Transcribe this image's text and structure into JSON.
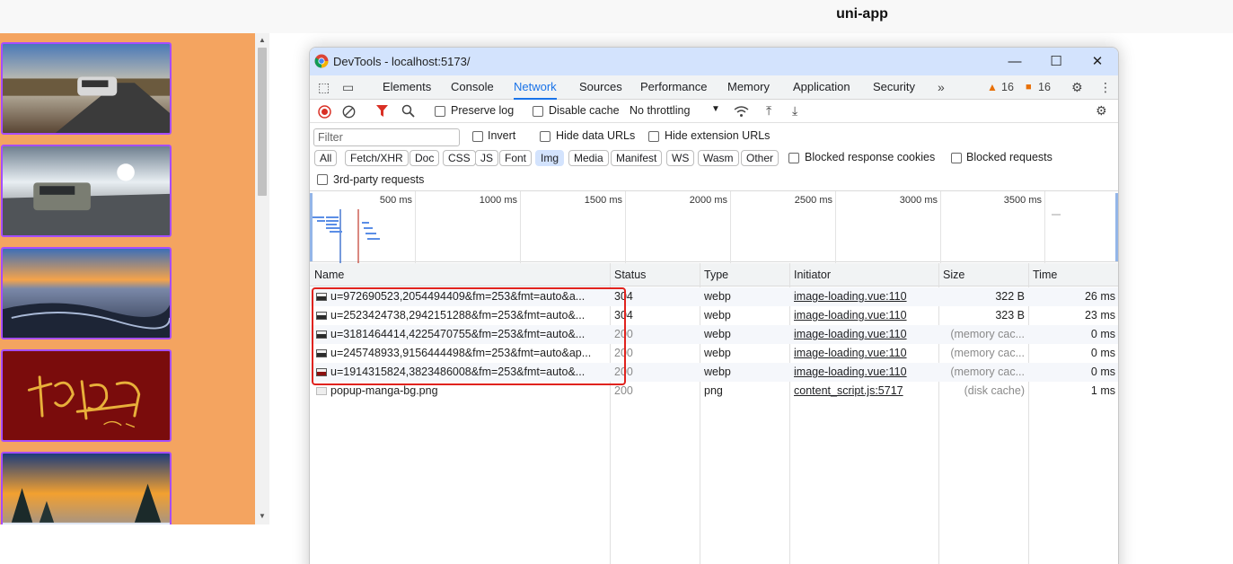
{
  "nav": {
    "title": "uni-app"
  },
  "left_panel": {
    "thumbnails": [
      {
        "name": "road-car-image"
      },
      {
        "name": "suv-highway-image"
      },
      {
        "name": "sunset-shore-image"
      },
      {
        "name": "calligraphy-image"
      },
      {
        "name": "winter-sunset-image"
      }
    ]
  },
  "devtools": {
    "title": "DevTools - localhost:5173/",
    "tabs": [
      "Elements",
      "Console",
      "Network",
      "Sources",
      "Performance",
      "Memory",
      "Application",
      "Security"
    ],
    "active_tab": "Network",
    "warnings_count": "16",
    "issues_count": "16",
    "toolbar": {
      "preserve_log": "Preserve log",
      "disable_cache": "Disable cache",
      "throttling": "No throttling"
    },
    "filter": {
      "placeholder": "Filter",
      "invert": "Invert",
      "hide_data_urls": "Hide data URLs",
      "hide_extension_urls": "Hide extension URLs",
      "types": [
        "All",
        "Fetch/XHR",
        "Doc",
        "CSS",
        "JS",
        "Font",
        "Img",
        "Media",
        "Manifest",
        "WS",
        "Wasm",
        "Other"
      ],
      "selected_type": "Img",
      "blocked_response_cookies": "Blocked response cookies",
      "blocked_requests": "Blocked requests",
      "third_party": "3rd-party requests"
    },
    "timeline": {
      "ticks": [
        "500 ms",
        "1000 ms",
        "1500 ms",
        "2000 ms",
        "2500 ms",
        "3000 ms",
        "3500 ms"
      ]
    },
    "columns": [
      "Name",
      "Status",
      "Type",
      "Initiator",
      "Size",
      "Time"
    ],
    "requests": [
      {
        "name": "u=972690523,2054494409&fm=253&fmt=auto&a...",
        "status": "304",
        "type": "webp",
        "initiator": "image-loading.vue:110",
        "size": "322 B",
        "time": "26 ms",
        "icon": "dark"
      },
      {
        "name": "u=2523424738,2942151288&fm=253&fmt=auto&...",
        "status": "304",
        "type": "webp",
        "initiator": "image-loading.vue:110",
        "size": "323 B",
        "time": "23 ms",
        "icon": "dark"
      },
      {
        "name": "u=3181464414,4225470755&fm=253&fmt=auto&...",
        "status": "200",
        "type": "webp",
        "initiator": "image-loading.vue:110",
        "size": "(memory cac...",
        "time": "0 ms",
        "icon": "dark"
      },
      {
        "name": "u=245748933,9156444498&fm=253&fmt=auto&ap...",
        "status": "200",
        "type": "webp",
        "initiator": "image-loading.vue:110",
        "size": "(memory cac...",
        "time": "0 ms",
        "icon": "dark"
      },
      {
        "name": "u=1914315824,3823486008&fm=253&fmt=auto&...",
        "status": "200",
        "type": "webp",
        "initiator": "image-loading.vue:110",
        "size": "(memory cac...",
        "time": "0 ms",
        "icon": "red"
      },
      {
        "name": "popup-manga-bg.png",
        "status": "200",
        "type": "png",
        "initiator": "content_script.js:5717",
        "size": "(disk cache)",
        "time": "1 ms",
        "icon": "light"
      }
    ],
    "colors": {
      "accent": "#1a73e8",
      "warning": "#e8710a",
      "issue": "#e8710a",
      "highlight_box": "#e0231e"
    }
  }
}
